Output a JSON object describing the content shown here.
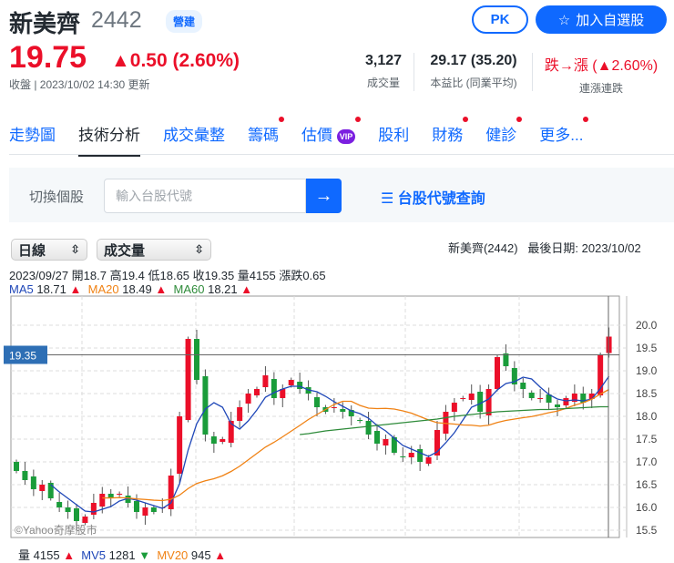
{
  "header": {
    "name": "新美齊",
    "code": "2442",
    "tag": "營建",
    "pk": "PK",
    "add": "加入自選股",
    "price": "19.75",
    "change": "▲0.50 (2.60%)",
    "updated": "收盤 | 2023/10/02 14:30 更新"
  },
  "stats": [
    {
      "value": "3,127",
      "label": "成交量"
    },
    {
      "value": "29.17 (35.20)",
      "label": "本益比 (同業平均)"
    },
    {
      "value": "跌→漲 (▲2.60%)",
      "label": "連漲連跌"
    }
  ],
  "tabs": [
    {
      "label": "走勢圖"
    },
    {
      "label": "技術分析"
    },
    {
      "label": "成交彙整"
    },
    {
      "label": "籌碼"
    },
    {
      "label": "估價",
      "badge": "VIP"
    },
    {
      "label": "股利"
    },
    {
      "label": "財務"
    },
    {
      "label": "健診"
    },
    {
      "label": "更多..."
    }
  ],
  "search": {
    "label": "切換個股",
    "placeholder": "輸入台股代號",
    "lookup": "台股代號查詢"
  },
  "controls": {
    "period": "日線",
    "indicator": "成交量",
    "info": "新美齊(2442)   最後日期: 2023/10/02"
  },
  "ohlc": "2023/09/27 開18.7 高19.4 低18.65 收19.35 量4155 漲跌0.65",
  "ma": {
    "ma5_label": "MA5",
    "ma5": "18.71",
    "ma20_label": "MA20",
    "ma20": "18.49",
    "ma60_label": "MA60",
    "ma60": "18.21",
    "arrow": "▲"
  },
  "volume": {
    "label": "量",
    "value": "4155",
    "mv5_label": "MV5",
    "mv5": "1281",
    "mv20_label": "MV20",
    "mv20": "945",
    "up": "▲",
    "down": "▼"
  },
  "watermark": "©Yahoo奇摩股市",
  "cursor_price": "19.35",
  "colors": {
    "up": "#eb0f29",
    "down": "#1a9c3a",
    "ma5": "#1f47b8",
    "ma20": "#f08214",
    "ma60": "#2e8b3a"
  },
  "chart_data": {
    "type": "candlestick",
    "ylim": [
      15.3,
      20.6
    ],
    "yticks": [
      "20.0",
      "19.5",
      "19.0",
      "18.5",
      "18.0",
      "17.5",
      "17.0",
      "16.5",
      "16.0",
      "15.5"
    ],
    "start_open": 17.0,
    "closes": [
      16.8,
      16.6,
      16.4,
      16.5,
      16.2,
      16.0,
      15.9,
      15.7,
      15.8,
      16.1,
      16.3,
      16.2,
      16.3,
      16.1,
      15.9,
      16.0,
      15.9,
      16.0,
      16.7,
      18.0,
      19.7,
      18.8,
      17.6,
      17.4,
      17.5,
      17.9,
      18.2,
      18.5,
      18.6,
      18.9,
      18.4,
      18.6,
      18.8,
      18.6,
      18.5,
      18.2,
      18.1,
      18.2,
      18.1,
      18.0,
      17.9,
      17.6,
      17.4,
      17.5,
      17.2,
      17.1,
      17.2,
      17.0,
      17.1,
      17.7,
      18.1,
      18.3,
      18.4,
      18.5,
      18.1,
      18.6,
      19.3,
      19.1,
      18.7,
      18.6,
      18.4,
      18.4,
      18.3,
      18.2,
      18.4,
      18.5,
      18.3,
      18.5,
      19.35,
      19.75
    ],
    "ma60": [
      null,
      null,
      null,
      null,
      null,
      null,
      null,
      null,
      null,
      null,
      null,
      null,
      null,
      null,
      null,
      null,
      null,
      null,
      null,
      null,
      null,
      null,
      null,
      null,
      null,
      null,
      null,
      null,
      null,
      null,
      null,
      null,
      null,
      17.6,
      17.62,
      17.65,
      17.68,
      17.7,
      17.72,
      17.74,
      17.76,
      17.78,
      17.8,
      17.82,
      17.84,
      17.86,
      17.88,
      17.9,
      17.92,
      17.94,
      17.97,
      18.0,
      18.02,
      18.04,
      18.06,
      18.08,
      18.1,
      18.11,
      18.12,
      18.13,
      18.14,
      18.15,
      18.15,
      18.16,
      18.17,
      18.18,
      18.19,
      18.2,
      18.21,
      18.21
    ]
  }
}
